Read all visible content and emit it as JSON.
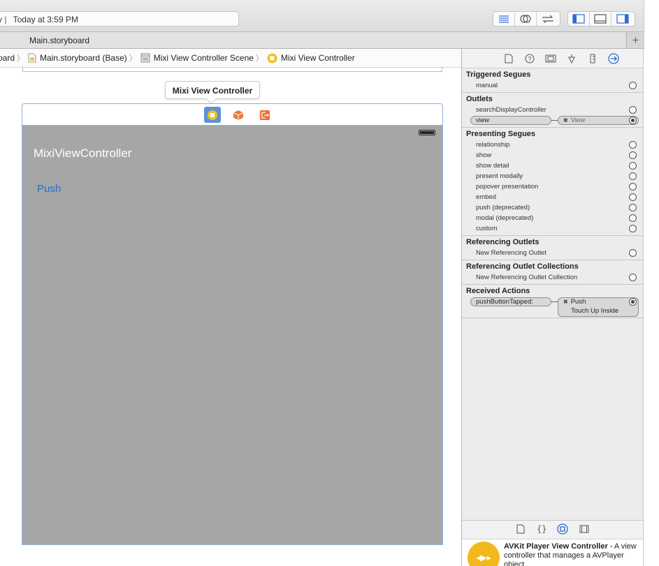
{
  "toolbar": {
    "activity_prefix": "y",
    "activity_status": "Today at 3:59 PM"
  },
  "tabbar": {
    "tab_label": "Main.storyboard",
    "add_tab_label": "+"
  },
  "jumpbar": {
    "crumbs": [
      "oard",
      "Main.storyboard (Base)",
      "Mixi View Controller Scene",
      "Mixi View Controller"
    ]
  },
  "canvas": {
    "scene_label": "Mixi View Controller",
    "vc_title": "MixiViewController",
    "push_button": "Push"
  },
  "inspector": {
    "triggered_segues": {
      "title": "Triggered Segues",
      "rows": [
        "manual"
      ]
    },
    "outlets": {
      "title": "Outlets",
      "rows": [
        "searchDisplayController",
        "view"
      ],
      "view_connection": "View"
    },
    "presenting_segues": {
      "title": "Presenting Segues",
      "rows": [
        "relationship",
        "show",
        "show detail",
        "present modally",
        "popover presentation",
        "embed",
        "push (deprecated)",
        "modal (deprecated)",
        "custom"
      ]
    },
    "referencing_outlets": {
      "title": "Referencing Outlets",
      "rows": [
        "New Referencing Outlet"
      ]
    },
    "referencing_outlet_collections": {
      "title": "Referencing Outlet Collections",
      "rows": [
        "New Referencing Outlet Collection"
      ]
    },
    "received_actions": {
      "title": "Received Actions",
      "action": "pushButtonTapped:",
      "target": "Push",
      "event": "Touch Up Inside"
    }
  },
  "library": {
    "item_title": "AVKit Player View Controller",
    "item_description": " - A view controller that manages a AVPlayer object"
  },
  "colors": {
    "accent": "#1f6fd3",
    "scene_background": "#a6a6a6",
    "selected_dock_icon": "#5d93d6",
    "library_icon": "#f3b91c"
  }
}
